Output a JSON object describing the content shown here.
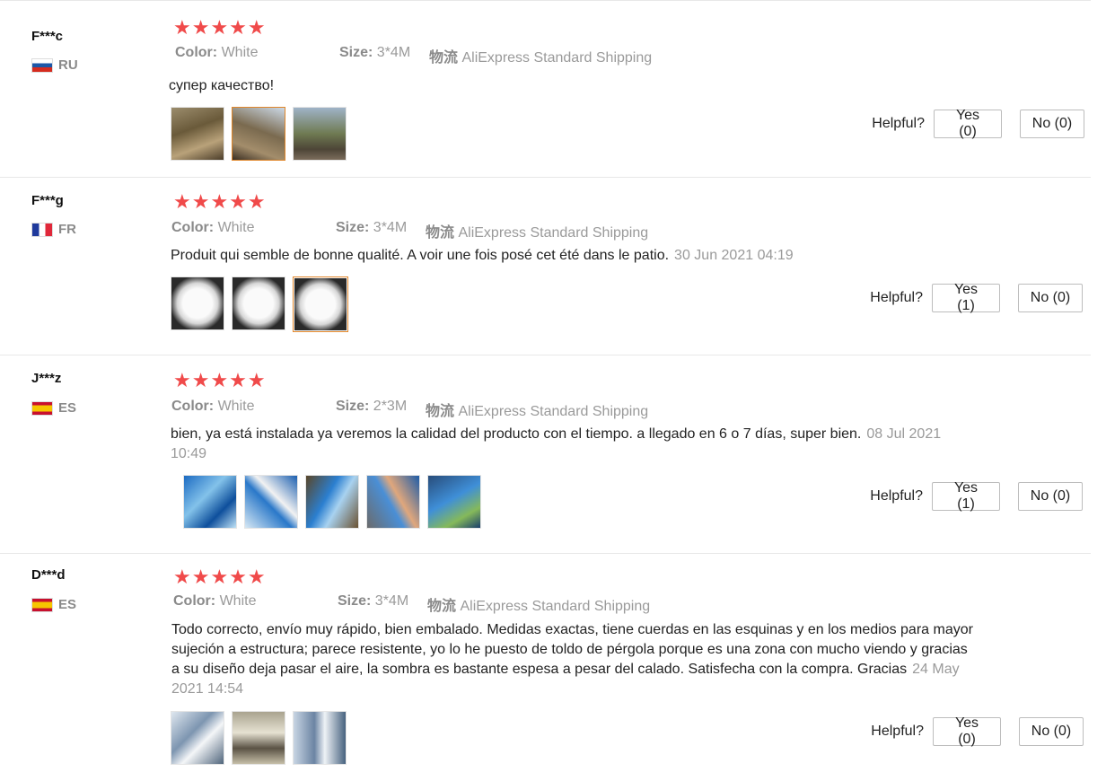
{
  "labels": {
    "color_label": "Color:",
    "size_label": "Size:",
    "ship_label": "物流",
    "helpful_label": "Helpful?",
    "stars": "★★★★★"
  },
  "reviews": [
    {
      "user": "F***c",
      "country": "RU",
      "color": "White",
      "size": "3*4M",
      "shipping": "AliExpress Standard Shipping",
      "text": "супер качество!",
      "date": "",
      "yes": "Yes (0)",
      "no": "No (0)",
      "images": [
        "review-photo-1",
        "review-photo-2",
        "review-photo-3"
      ]
    },
    {
      "user": "F***g",
      "country": "FR",
      "color": "White",
      "size": "3*4M",
      "shipping": "AliExpress Standard Shipping",
      "text": "Produit qui semble de bonne qualité. A voir une fois posé cet été dans le patio.",
      "date": "30 Jun 2021 04:19",
      "yes": "Yes (1)",
      "no": "No (0)",
      "images": [
        "review-photo-1",
        "review-photo-2",
        "review-photo-3"
      ]
    },
    {
      "user": "J***z",
      "country": "ES",
      "color": "White",
      "size": "2*3M",
      "shipping": "AliExpress Standard Shipping",
      "text": "bien, ya está instalada ya veremos la calidad del producto con el tiempo. a llegado en 6 o 7 días, super bien.",
      "date": "08 Jul 2021 10:49",
      "yes": "Yes (1)",
      "no": "No (0)",
      "images": [
        "review-photo-1",
        "review-photo-2",
        "review-photo-3",
        "review-photo-4",
        "review-photo-5"
      ]
    },
    {
      "user": "D***d",
      "country": "ES",
      "color": "White",
      "size": "3*4M",
      "shipping": "AliExpress Standard Shipping",
      "text": "Todo correcto, envío muy rápido, bien embalado. Medidas exactas, tiene cuerdas en las esquinas y en los medios para mayor sujeción a estructura; parece resistente, yo lo he puesto de toldo de pérgola porque es una zona con mucho viendo y gracias a su diseño deja pasar el aire, la sombra es bastante espesa a pesar del calado. Satisfecha con la compra. Gracias",
      "date": "24 May 2021 14:54",
      "yes": "Yes (0)",
      "no": "No (0)",
      "images": [
        "review-photo-1",
        "review-photo-2",
        "review-photo-3"
      ]
    }
  ]
}
